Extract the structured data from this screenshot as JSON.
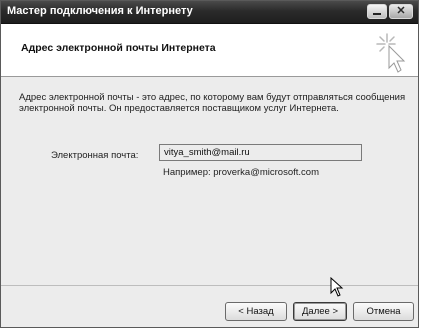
{
  "window": {
    "title": "Мастер подключения к Интернету",
    "minimize_label": "",
    "close_label": "✕"
  },
  "header": {
    "title": "Адрес электронной почты Интернета",
    "icon": "wizard-cursor-icon"
  },
  "body": {
    "description": "Адрес электронной почты - это адрес, по которому вам будут отправляться сообщения электронной почты. Он предоставляется поставщиком услуг Интернета.",
    "email_label": "Электронная почта:",
    "email_value": "vitya_smith@mail.ru",
    "example": "Например: proverka@microsoft.com"
  },
  "buttons": {
    "back": "< Назад",
    "next": "Далее >",
    "cancel": "Отмена"
  }
}
